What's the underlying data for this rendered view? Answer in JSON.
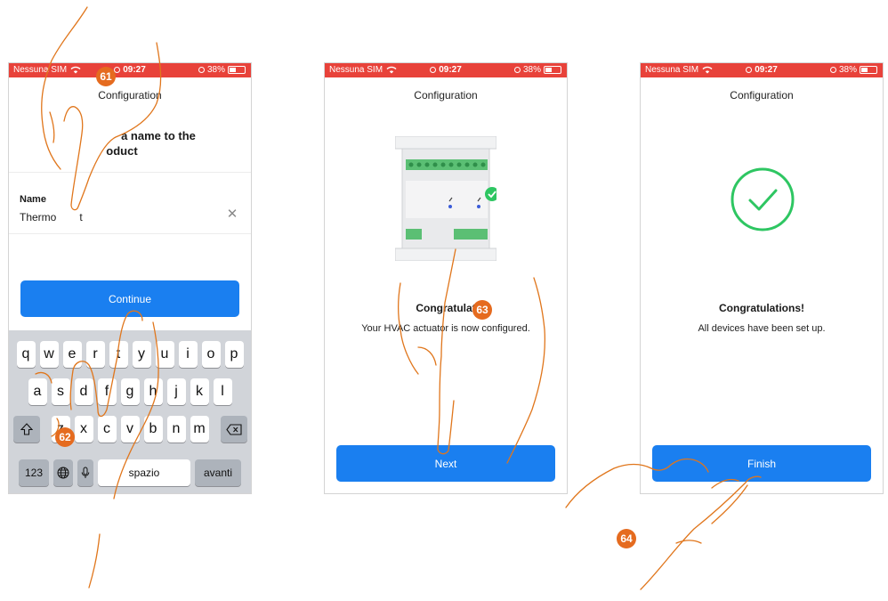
{
  "status_bar": {
    "carrier": "Nessuna SIM",
    "time": "09:27",
    "battery": "38%"
  },
  "screen1": {
    "nav_title": "Configuration",
    "heading_line1": "a name to the",
    "heading_line2": "oduct",
    "field_label": "Name",
    "field_value": "Thermo",
    "field_value_tail": "t",
    "continue_label": "Continue",
    "keyboard": {
      "row1": [
        "q",
        "w",
        "e",
        "r",
        "t",
        "y",
        "u",
        "i",
        "o",
        "p"
      ],
      "row2": [
        "a",
        "s",
        "d",
        "f",
        "g",
        "h",
        "j",
        "k",
        "l"
      ],
      "row3": [
        "z",
        "x",
        "c",
        "v",
        "b",
        "n",
        "m"
      ],
      "numbers_key": "123",
      "space_key": "spazio",
      "return_key": "avanti"
    }
  },
  "screen2": {
    "nav_title": "Configuration",
    "heading": "Congratulat",
    "subtitle": "Your HVAC actuator is now configured.",
    "next_label": "Next"
  },
  "screen3": {
    "nav_title": "Configuration",
    "heading": "Congratulations!",
    "subtitle": "All devices have been set up.",
    "finish_label": "Finish"
  },
  "callouts": {
    "c61": "61",
    "c62": "62",
    "c63": "63",
    "c64": "64"
  },
  "colors": {
    "status_bar": "#e8423a",
    "button": "#1a7ff0",
    "success": "#2ec662",
    "callout": "#e56b1f",
    "hand_outline": "#e0761c"
  },
  "icons": [
    "wifi-icon",
    "alarm-icon",
    "battery-icon",
    "clear-icon",
    "shift-icon",
    "backspace-icon",
    "globe-icon",
    "microphone-icon",
    "checkmark-badge-icon",
    "success-check-icon",
    "hand-pointer-icon"
  ]
}
